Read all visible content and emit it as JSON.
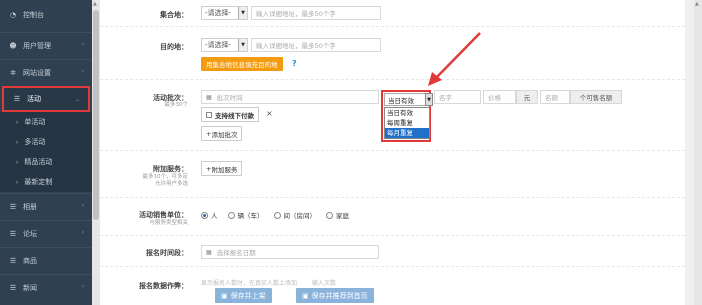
{
  "sidebar": {
    "items": [
      {
        "label": "控制台",
        "icon": "dashboard-icon",
        "glyph": "◔"
      },
      {
        "label": "用户管理",
        "icon": "users-icon",
        "glyph": "☻"
      },
      {
        "label": "网站设置",
        "icon": "gear-icon",
        "glyph": "✲"
      },
      {
        "label": "活动",
        "icon": "list-icon",
        "glyph": "☰"
      },
      {
        "label": "相册",
        "icon": "list-icon",
        "glyph": "☰"
      },
      {
        "label": "论坛",
        "icon": "list-icon",
        "glyph": "☰"
      },
      {
        "label": "商品",
        "icon": "list-icon",
        "glyph": "☰"
      },
      {
        "label": "新闻",
        "icon": "list-icon",
        "glyph": "☰"
      }
    ],
    "sub_items": [
      "单活动",
      "多活动",
      "精品活动",
      "最新定制"
    ]
  },
  "form": {
    "gather_label": "集合地：",
    "gather_select": "-请选择-",
    "gather_placeholder": "输入详细地址，最多50个字",
    "dest_label": "目的地：",
    "dest_select": "-请选择-",
    "dest_placeholder": "输入详细地址，最多50个字",
    "copy_btn": "用集合地信息填充目的地",
    "help": "?",
    "batch_label": "活动批次：",
    "batch_hint": "最多30个",
    "batch_time_placeholder": "批次时间",
    "batch_name_placeholder": "名字",
    "batch_price_placeholder": "价格",
    "batch_price_unit": "元",
    "batch_quota_placeholder": "名额",
    "batch_nonsale_quota": "个可售名额",
    "offline_pay": "支持线下付款",
    "add_batch": "添加批次",
    "addon_label": "附加服务：",
    "addon_hint1": "最多10个，可多定",
    "addon_hint2": "允许用户多选",
    "addon_btn": "附加服务",
    "unit_label": "活动销售单位：",
    "unit_hint": "与服务类型相关",
    "units": [
      "人",
      "辆（车）",
      "间（房间）",
      "家庭"
    ],
    "signup_label": "报名时间段：",
    "signup_placeholder": "选择报名日期",
    "count_label": "报名数据作弊：",
    "count_faded_a": "显示报名人数时，在真实人数上添加",
    "count_faded_b": "输入次数",
    "save_publish": "保存并上架",
    "save_home": "保存并推荐到首页"
  },
  "repeat_dropdown": {
    "current": "当日有效",
    "options": [
      "当日有效",
      "每周重复",
      "每月重复"
    ],
    "highlighted": "每月重复"
  },
  "colors": {
    "sidebar_bg": "#2f4050",
    "highlight": "#e03a3a",
    "orange": "#f39c12",
    "blue": "#1e70c9"
  }
}
